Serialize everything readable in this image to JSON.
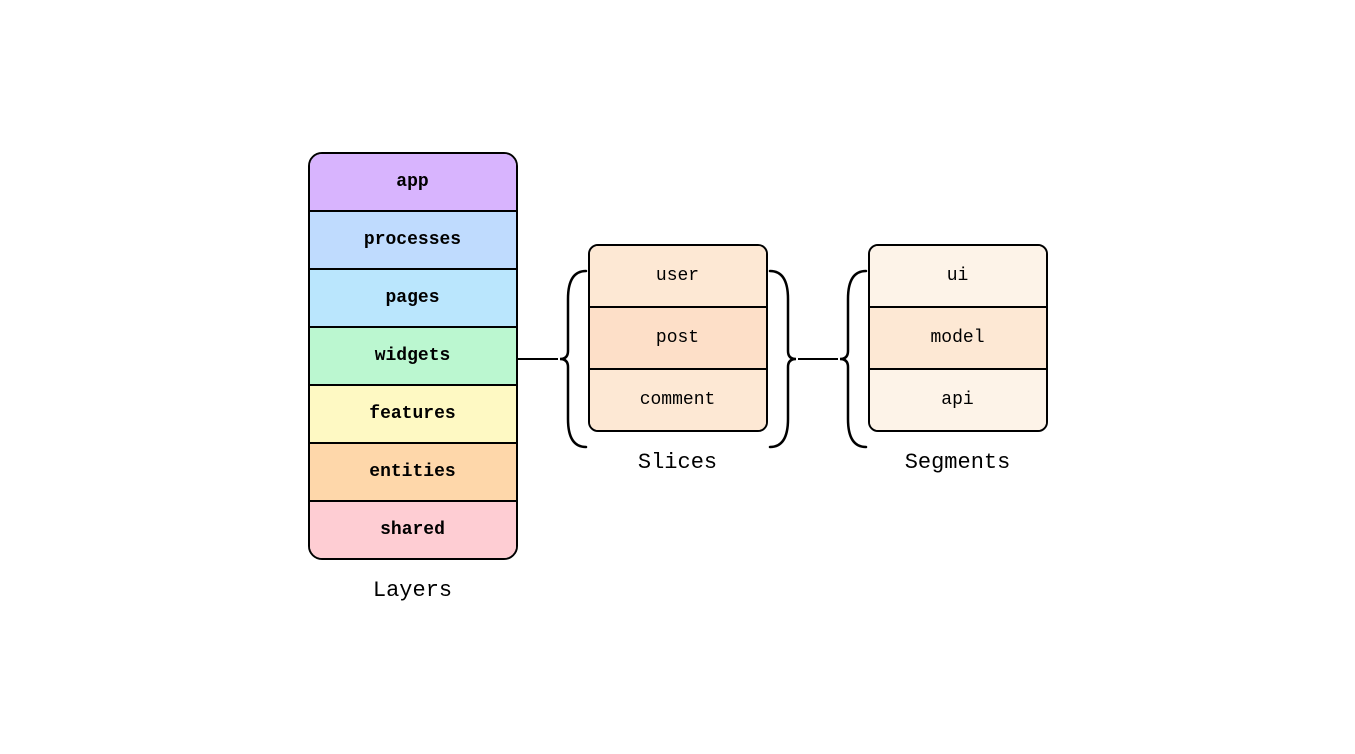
{
  "layers": {
    "label": "Layers",
    "items": [
      {
        "name": "app",
        "class": "layer-app"
      },
      {
        "name": "processes",
        "class": "layer-processes"
      },
      {
        "name": "pages",
        "class": "layer-pages"
      },
      {
        "name": "widgets",
        "class": "layer-widgets"
      },
      {
        "name": "features",
        "class": "layer-features"
      },
      {
        "name": "entities",
        "class": "layer-entities"
      },
      {
        "name": "shared",
        "class": "layer-shared"
      }
    ]
  },
  "slices": {
    "label": "Slices",
    "items": [
      {
        "name": "user",
        "class": "slice-user"
      },
      {
        "name": "post",
        "class": "slice-post"
      },
      {
        "name": "comment",
        "class": "slice-comment"
      }
    ]
  },
  "segments": {
    "label": "Segments",
    "items": [
      {
        "name": "ui",
        "class": "segment-ui"
      },
      {
        "name": "model",
        "class": "segment-model"
      },
      {
        "name": "api",
        "class": "segment-api"
      }
    ]
  },
  "connector": {
    "line_color": "#000000"
  }
}
